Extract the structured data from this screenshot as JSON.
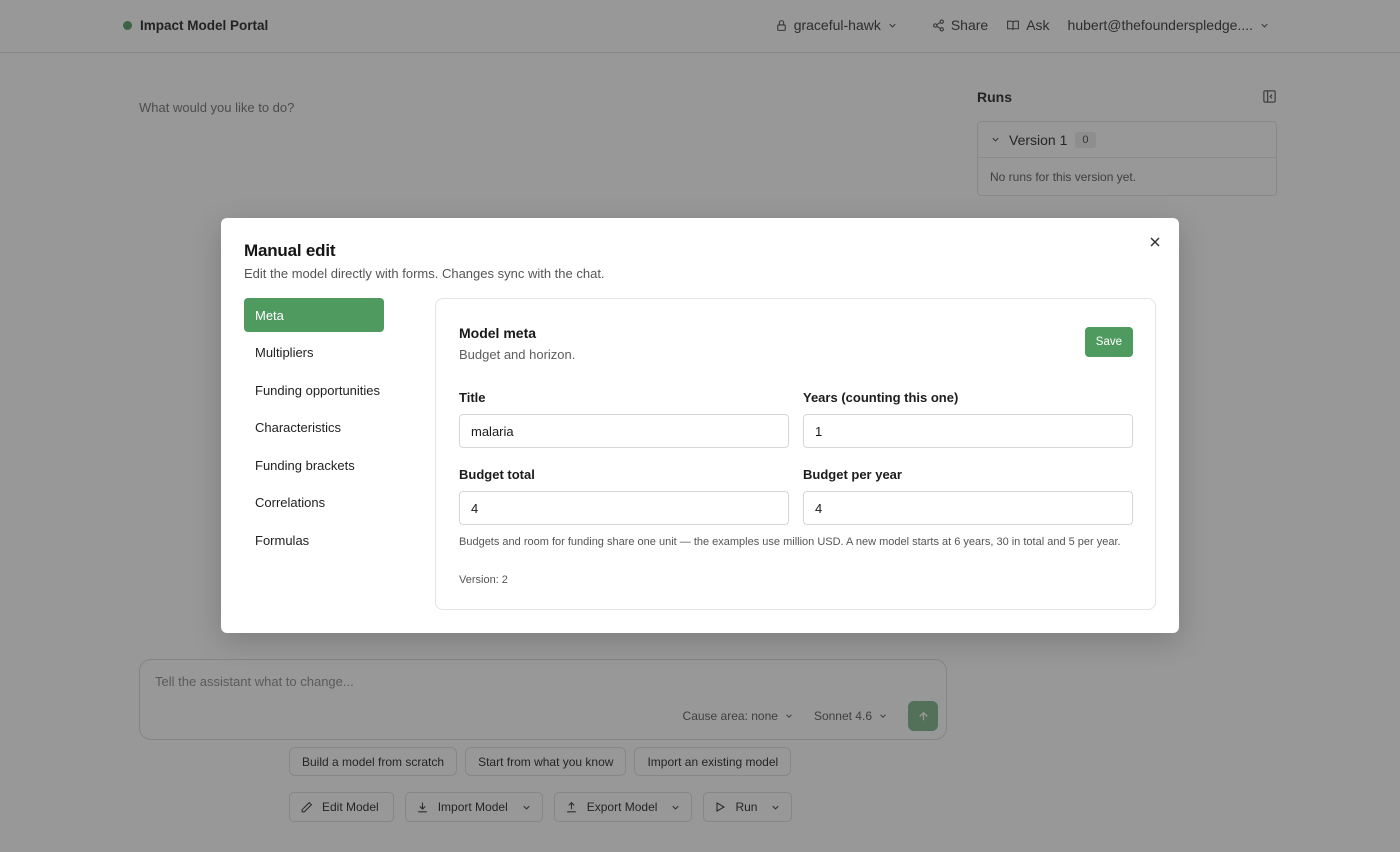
{
  "app": {
    "title": "Impact Model Portal",
    "status_color": "#4f9a5e"
  },
  "header": {
    "project_name": "graceful-hawk",
    "share_label": "Share",
    "ask_label": "Ask",
    "user_email": "hubert@thefounderspledge...."
  },
  "main": {
    "prompt": "What would you like to do?"
  },
  "runs": {
    "title": "Runs",
    "version_label": "Version 1",
    "version_count": "0",
    "empty_text": "No runs for this version yet."
  },
  "composer": {
    "placeholder": "Tell the assistant what to change...",
    "cause_area": "Cause area: none",
    "model": "Sonnet 4.6"
  },
  "suggestions": [
    "Build a model from scratch",
    "Start from what you know",
    "Import an existing model"
  ],
  "toolbar": {
    "edit_model": "Edit Model",
    "import_model": "Import Model",
    "export_model": "Export Model",
    "run": "Run"
  },
  "modal": {
    "title": "Manual edit",
    "subtitle": "Edit the model directly with forms. Changes sync with the chat.",
    "nav": [
      "Meta",
      "Multipliers",
      "Funding opportunities",
      "Characteristics",
      "Funding brackets",
      "Correlations",
      "Formulas"
    ],
    "active_nav": "Meta",
    "panel": {
      "title": "Model meta",
      "subtitle": "Budget and horizon.",
      "save_label": "Save",
      "fields": {
        "title_label": "Title",
        "title_value": "malaria",
        "years_label": "Years (counting this one)",
        "years_value": "1",
        "budget_total_label": "Budget total",
        "budget_total_value": "4",
        "budget_per_year_label": "Budget per year",
        "budget_per_year_value": "4"
      },
      "help_note": "Budgets and room for funding share one unit — the examples use million USD. A new model starts at 6 years, 30 in total and 5 per year.",
      "version_note": "Version: 2"
    }
  },
  "colors": {
    "accent": "#4f9a5e",
    "overlay": "rgba(40,40,40,0.48)"
  }
}
